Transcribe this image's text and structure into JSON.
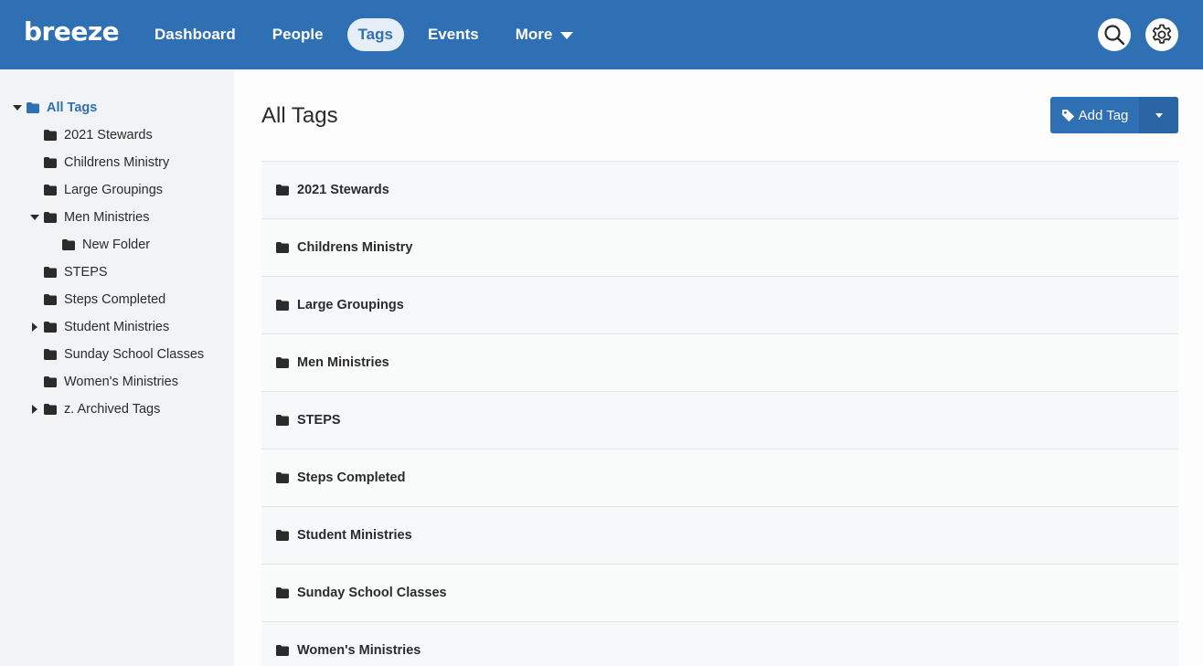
{
  "header": {
    "logo": "breeze",
    "nav": [
      {
        "label": "Dashboard"
      },
      {
        "label": "People"
      },
      {
        "label": "Tags"
      },
      {
        "label": "Events"
      },
      {
        "label": "More"
      }
    ],
    "active_nav": "Tags"
  },
  "sidebar": {
    "root": "All Tags",
    "items": [
      {
        "label": "2021 Stewards"
      },
      {
        "label": "Childrens Ministry"
      },
      {
        "label": "Large Groupings"
      },
      {
        "label": "Men Ministries"
      },
      {
        "label": "New Folder"
      },
      {
        "label": "STEPS"
      },
      {
        "label": "Steps Completed"
      },
      {
        "label": "Student Ministries"
      },
      {
        "label": "Sunday School Classes"
      },
      {
        "label": "Women's Ministries"
      },
      {
        "label": "z. Archived Tags"
      }
    ]
  },
  "main": {
    "title": "All Tags",
    "add_tag_label": "Add Tag",
    "tags": [
      {
        "label": "2021 Stewards"
      },
      {
        "label": "Childrens Ministry"
      },
      {
        "label": "Large Groupings"
      },
      {
        "label": "Men Ministries"
      },
      {
        "label": "STEPS"
      },
      {
        "label": "Steps Completed"
      },
      {
        "label": "Student Ministries"
      },
      {
        "label": "Sunday School Classes"
      },
      {
        "label": "Women's Ministries"
      }
    ]
  },
  "colors": {
    "brand": "#2f70b5",
    "sidebar_bg": "#f2f3f4",
    "active_tab_bg": "#e6eef8"
  },
  "icons": {
    "folder": "folder-icon",
    "search": "search-icon",
    "settings": "gear-icon",
    "tag": "tag-icon"
  }
}
